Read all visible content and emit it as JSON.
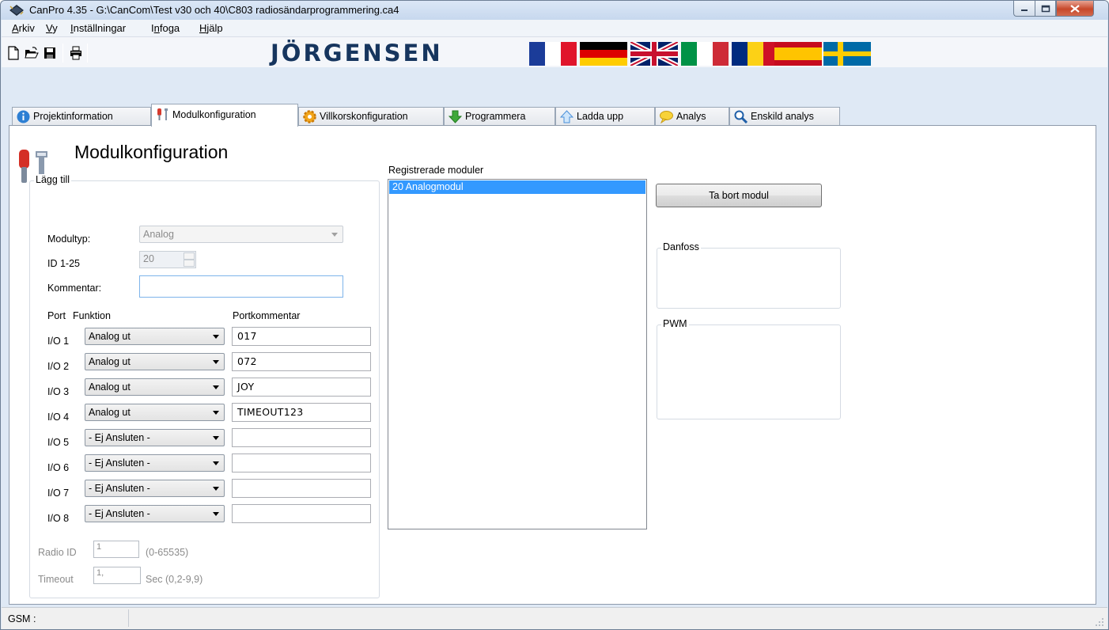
{
  "window": {
    "title": "CanPro 4.35 - G:\\CanCom\\Test v30 och 40\\C803 radiosändarprogrammering.ca4"
  },
  "menu": [
    {
      "label": "Arkiv",
      "underline": "A",
      "rest": "rkiv"
    },
    {
      "label": "Vy",
      "underline": "V",
      "rest": "y"
    },
    {
      "label": "Inställningar",
      "underline": "I",
      "rest": "nställningar"
    },
    {
      "label": "Infoga",
      "underline": "n",
      "pre": "I",
      "rest": "foga"
    },
    {
      "label": "Hjälp",
      "underline": "H",
      "rest": "jälp"
    }
  ],
  "toolbar": {
    "icons": [
      "new-file-icon",
      "open-folder-icon",
      "save-disk-icon",
      "print-icon"
    ],
    "brand": "JÖRGENSEN",
    "flags": [
      "france-flag",
      "germany-flag",
      "uk-flag",
      "italy-flag",
      "romania-flag",
      "spain-flag",
      "sweden-flag"
    ]
  },
  "tabs": [
    {
      "label": "Projektinformation",
      "icon": "info-icon"
    },
    {
      "label": "Modulkonfiguration",
      "icon": "tools-icon",
      "active": true
    },
    {
      "label": "Villkorskonfiguration",
      "icon": "gear-icon"
    },
    {
      "label": "Programmera",
      "icon": "download-arrow-icon"
    },
    {
      "label": "Ladda upp",
      "icon": "upload-arrow-icon"
    },
    {
      "label": "Analys",
      "icon": "speech-bubble-icon"
    },
    {
      "label": "Enskild analys",
      "icon": "magnifier-icon"
    }
  ],
  "page": {
    "title": "Modulkonfiguration",
    "add_group": {
      "legend": "Lägg till",
      "modultyp_label": "Modultyp:",
      "modultyp_value": "Analog",
      "id_label": "ID  1-25",
      "id_value": "20",
      "kommentar_label": "Kommentar:",
      "kommentar_value": "",
      "col_port": "Port",
      "col_funktion": "Funktion",
      "col_portkommentar": "Portkommentar",
      "ports": [
        {
          "port": "I/O 1",
          "funktion": "Analog ut",
          "kommentar": "017"
        },
        {
          "port": "I/O 2",
          "funktion": "Analog ut",
          "kommentar": "072"
        },
        {
          "port": "I/O 3",
          "funktion": "Analog ut",
          "kommentar": "JOY"
        },
        {
          "port": "I/O 4",
          "funktion": "Analog ut",
          "kommentar": "TIMEOUT123"
        },
        {
          "port": "I/O 5",
          "funktion": "- Ej Ansluten -",
          "kommentar": ""
        },
        {
          "port": "I/O 6",
          "funktion": "- Ej Ansluten -",
          "kommentar": ""
        },
        {
          "port": "I/O 7",
          "funktion": "- Ej Ansluten -",
          "kommentar": ""
        },
        {
          "port": "I/O 8",
          "funktion": "- Ej Ansluten -",
          "kommentar": ""
        }
      ],
      "radio_id_label": "Radio ID",
      "radio_id_value": "1",
      "radio_id_range": "(0-65535)",
      "timeout_label": "Timeout",
      "timeout_value": "1,",
      "timeout_range": "Sec (0,2-9,9)"
    },
    "registered": {
      "label": "Registrerade moduler",
      "items": [
        "20  Analogmodul"
      ]
    },
    "remove_button": "Ta bort modul",
    "danfoss_legend": "Danfoss",
    "pwm_legend": "PWM"
  },
  "statusbar": {
    "text": "GSM :"
  }
}
